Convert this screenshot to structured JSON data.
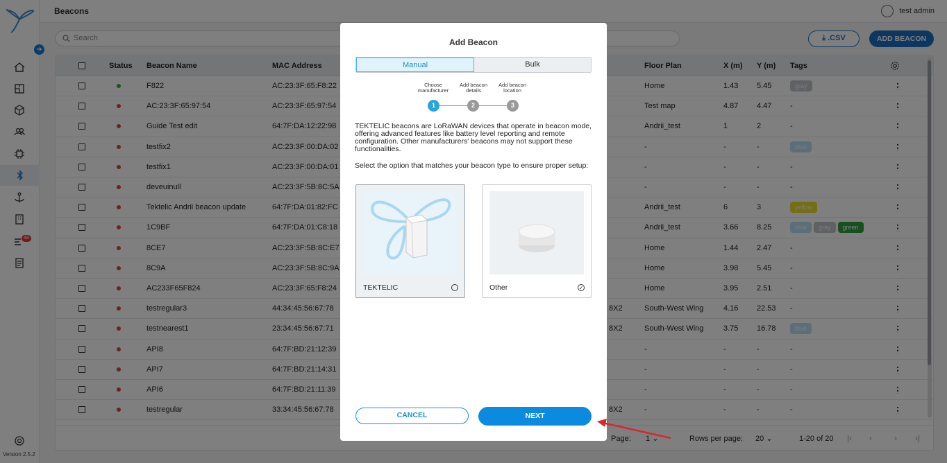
{
  "app": {
    "page_title": "Beacons",
    "user_name": "test admin",
    "version": "Version 2.5.2",
    "notification_count": "48"
  },
  "toolbar": {
    "search_placeholder": "Search",
    "csv_label": ".CSV",
    "add_label": "ADD BEACON"
  },
  "table": {
    "headers": {
      "status": "Status",
      "name": "Beacon Name",
      "mac": "MAC Address",
      "floor": "Floor Plan",
      "x": "X (m)",
      "y": "Y (m)",
      "tags": "Tags"
    },
    "rows": [
      {
        "status": "green",
        "name": "F822",
        "mac": "AC:23:3F:65:F8:22",
        "extra": "",
        "floor": "Home",
        "x": "1.43",
        "y": "5.45",
        "tags": [
          {
            "t": "gray",
            "c": "#bfc3c8"
          }
        ]
      },
      {
        "status": "red",
        "name": "AC:23:3F:65:97:54",
        "mac": "AC:23:3F:65:97:54",
        "extra": "",
        "floor": "Test map",
        "x": "4.87",
        "y": "4.47",
        "tags": []
      },
      {
        "status": "red",
        "name": "Guide Test edit",
        "mac": "64:7F:DA:12:22:98",
        "extra": "",
        "floor": "Andrii_test",
        "x": "1",
        "y": "2",
        "tags": []
      },
      {
        "status": "red",
        "name": "testfix2",
        "mac": "AC:23:3F:00:DA:02",
        "extra": "",
        "floor": "-",
        "x": "-",
        "y": "-",
        "tags": [
          {
            "t": "blue",
            "c": "#b9dcf0"
          }
        ]
      },
      {
        "status": "red",
        "name": "testfix1",
        "mac": "AC:23:3F:00:DA:01",
        "extra": "",
        "floor": "-",
        "x": "-",
        "y": "-",
        "tags": []
      },
      {
        "status": "red",
        "name": "deveuinull",
        "mac": "AC:23:3F:5B:8C:5A",
        "extra": "",
        "floor": "-",
        "x": "-",
        "y": "-",
        "tags": []
      },
      {
        "status": "red",
        "name": "Tektelic Andrii beacon update",
        "mac": "64:7F:DA:01:82:FC",
        "extra": "",
        "floor": "Andrii_test",
        "x": "6",
        "y": "3",
        "tags": [
          {
            "t": "yellow",
            "c": "#e8dc2a"
          }
        ]
      },
      {
        "status": "red",
        "name": "1C9BF",
        "mac": "64:7F:DA:01:C8:18",
        "extra": "",
        "floor": "Andrii_test",
        "x": "3.66",
        "y": "8.25",
        "tags": [
          {
            "t": "blue",
            "c": "#b9dcf0"
          },
          {
            "t": "gray",
            "c": "#bfc3c8"
          },
          {
            "t": "green",
            "c": "#2e9e3e"
          }
        ]
      },
      {
        "status": "red",
        "name": "8CE7",
        "mac": "AC:23:3F:5B:8C:E7",
        "extra": "",
        "floor": "Home",
        "x": "1.44",
        "y": "2.47",
        "tags": []
      },
      {
        "status": "red",
        "name": "8C9A",
        "mac": "AC:23:3F:5B:8C:9A",
        "extra": "",
        "floor": "Home",
        "x": "3.98",
        "y": "5.45",
        "tags": []
      },
      {
        "status": "red",
        "name": "AC233F65F824",
        "mac": "AC:23:3F:65:F8:24",
        "extra": "",
        "floor": "Home",
        "x": "3.95",
        "y": "2.51",
        "tags": []
      },
      {
        "status": "red",
        "name": "testregular3",
        "mac": "44:34:45:56:67:78",
        "extra": "8X2",
        "floor": "South-West Wing",
        "x": "4.16",
        "y": "22.53",
        "tags": []
      },
      {
        "status": "red",
        "name": "testnearest1",
        "mac": "23:34:45:56:67:71",
        "extra": "8X2",
        "floor": "South-West Wing",
        "x": "3.75",
        "y": "16.78",
        "tags": [
          {
            "t": "blue",
            "c": "#b9dcf0"
          }
        ]
      },
      {
        "status": "red",
        "name": "API8",
        "mac": "64:7F:BD:21:12:39",
        "extra": "",
        "floor": "-",
        "x": "-",
        "y": "-",
        "tags": []
      },
      {
        "status": "red",
        "name": "API7",
        "mac": "64:7F:BD:21:14:31",
        "extra": "",
        "floor": "-",
        "x": "-",
        "y": "-",
        "tags": []
      },
      {
        "status": "red",
        "name": "API6",
        "mac": "64:7F:BD:21:11:39",
        "extra": "",
        "floor": "-",
        "x": "-",
        "y": "-",
        "tags": []
      },
      {
        "status": "red",
        "name": "testregular",
        "mac": "33:34:45:56:67:78",
        "extra": "8X2",
        "floor": "-",
        "x": "-",
        "y": "-",
        "tags": []
      }
    ],
    "status_colors": {
      "green": "#3aa93a",
      "red": "#d9443a"
    }
  },
  "footer": {
    "page_label": "Page:",
    "page_value": "1",
    "rows_label": "Rows per page:",
    "rows_value": "20",
    "range": "1-20 of 20"
  },
  "modal": {
    "title": "Add Beacon",
    "tab_manual": "Manual",
    "tab_bulk": "Bulk",
    "steps": [
      {
        "line1": "Choose",
        "line2": "manufacturer",
        "num": "1",
        "active": true
      },
      {
        "line1": "Add beacon",
        "line2": "details",
        "num": "2",
        "active": false
      },
      {
        "line1": "Add beacon",
        "line2": "location",
        "num": "3",
        "active": false
      }
    ],
    "para1": "TEKTELIC beacons are LoRaWAN devices that operate in beacon mode, offering advanced features like battery level reporting and remote configuration. Other manufacturers' beacons may not support these functionalities.",
    "para2": "Select the option that matches your beacon type to ensure proper setup:",
    "option_tektelic": "TEKTELIC",
    "option_other": "Other",
    "cancel_label": "CANCEL",
    "next_label": "NEXT"
  }
}
